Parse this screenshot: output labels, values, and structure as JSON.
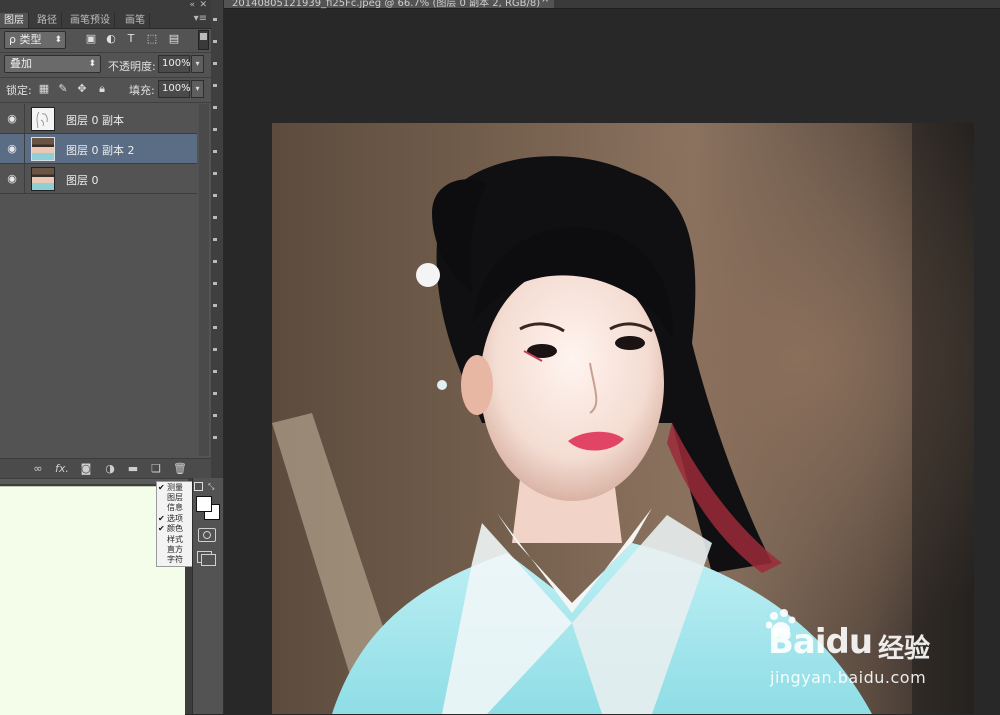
{
  "layers_panel": {
    "tabs": [
      "图层",
      "路径",
      "画笔预设",
      "画笔"
    ],
    "active_tab": "图层",
    "collapse_icon": "double-chevron-left",
    "close_icon": "close-x",
    "menu_icon": "panel-menu",
    "filter": {
      "label": "ρ 类型",
      "arrow": "⬍"
    },
    "filter_icons": [
      "image-icon",
      "adjustment-circle-icon",
      "type-T-icon",
      "shape-icon",
      "smart-object-icon"
    ],
    "blend_mode": "叠加",
    "opacity_label": "不透明度:",
    "opacity_value": "100%",
    "lock_label": "锁定:",
    "lock_icons": [
      "lock-transparent-icon",
      "lock-paint-icon",
      "lock-move-icon",
      "lock-all-icon"
    ],
    "fill_label": "填充:",
    "fill_value": "100%",
    "layers": [
      {
        "name": "图层 0 副本",
        "visible": true,
        "selected": false,
        "thumb": "sketch"
      },
      {
        "name": "图层 0 副本 2",
        "visible": true,
        "selected": true,
        "thumb": "photo"
      },
      {
        "name": "图层 0",
        "visible": true,
        "selected": false,
        "thumb": "photo"
      }
    ],
    "bottom_icons": [
      "link-icon",
      "fx",
      "mask-icon",
      "adjustment-icon",
      "folder-icon",
      "new-layer-icon",
      "trash-icon"
    ],
    "fx_label": "fx."
  },
  "context_menu": {
    "items": [
      {
        "label": "测量",
        "checked": true
      },
      {
        "label": "图层",
        "checked": false
      },
      {
        "label": "信息",
        "checked": false
      },
      {
        "label": "选项",
        "checked": true
      },
      {
        "label": "颜色",
        "checked": true
      },
      {
        "label": "样式",
        "checked": false
      },
      {
        "label": "直方",
        "checked": false
      },
      {
        "label": "字符",
        "checked": false
      }
    ]
  },
  "tools": {
    "foreground_color": "#ffffff",
    "background_color": "#ffffff"
  },
  "document": {
    "tab_title": "20140805121939_fi25Fc.jpeg @ 66.7% (图层 0 副本 2, RGB/8)",
    "tab_close": "×"
  },
  "watermark": {
    "logo_text": "Baidu",
    "cn_text": "经验",
    "url": "jingyan.baidu.com"
  },
  "colors": {
    "panel_bg": "#535353",
    "selected_row": "#5b6d85",
    "pasteboard": "#282828",
    "lower_doc_bg": "#f3fdea"
  }
}
